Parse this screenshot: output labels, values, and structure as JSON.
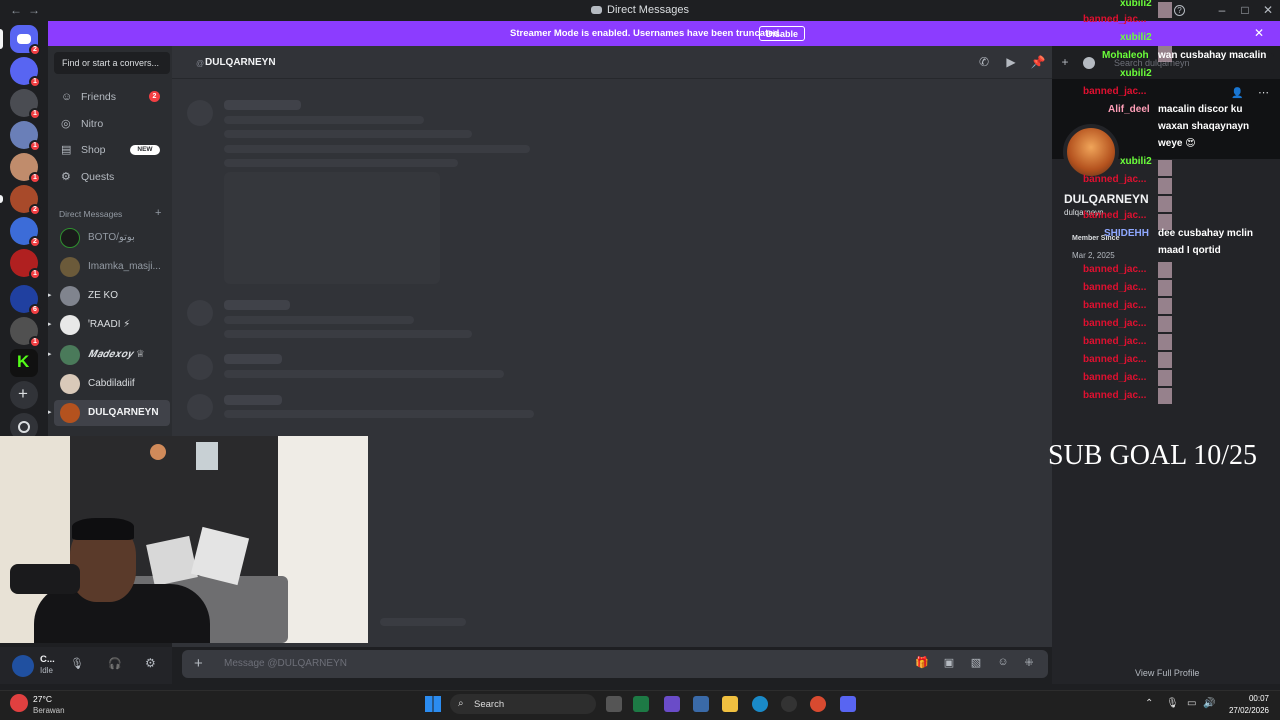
{
  "window": {
    "title": "Direct Messages",
    "back": "←",
    "forward": "→",
    "help": "?",
    "minimize": "–",
    "maximize": "□",
    "close": "✕"
  },
  "banner": {
    "message": "Streamer Mode is enabled. Usernames have been truncated.",
    "disable_label": "Disable",
    "close": "✕"
  },
  "servers": {
    "badges": [
      "2",
      "1",
      "1",
      "1",
      "1",
      "2",
      "2",
      "1",
      "6",
      "1"
    ]
  },
  "sidebar": {
    "search_label": "Find or start a convers...",
    "nav": [
      {
        "label": "Friends",
        "badge": "2"
      },
      {
        "label": "Nitro"
      },
      {
        "label": "Shop",
        "badge_new": "NEW"
      },
      {
        "label": "Quests"
      }
    ],
    "dm_header": "Direct Messages",
    "dm_plus": "+",
    "dms": [
      {
        "name": "BOTO/بوتو"
      },
      {
        "name": "Imamka_masji..."
      },
      {
        "name": "ZE KO"
      },
      {
        "name": "ꞌRAADI ⚡"
      },
      {
        "name": "𝑴𝒂𝒅𝒆𝒙𝒐𝒚 ♕"
      },
      {
        "name": "Cabdiladiif"
      },
      {
        "name": "DULQARNEYN"
      }
    ]
  },
  "header": {
    "at": "@",
    "name": "DULQARNEYN",
    "search_placeholder": "Search dulqarneyn"
  },
  "composer": {
    "placeholder": "Message @DULQARNEYN",
    "plus": "+"
  },
  "user_panel": {
    "name": "C...",
    "status": "Idle"
  },
  "profile": {
    "display_name": "DULQARNEYN",
    "username": "dulqarneyn",
    "member_since_label": "Member Since",
    "member_since": "Mar 2, 2025",
    "view_full": "View Full Profile"
  },
  "chat": [
    {
      "user": "xubili2",
      "color": "green"
    },
    {
      "user": "banned_jac...",
      "color": "red"
    },
    {
      "user": "xubili2",
      "color": "green"
    },
    {
      "user": "Mohaleoh",
      "color": "green",
      "text": "wan cusbahay macalin"
    },
    {
      "user": "xubili2",
      "color": "green"
    },
    {
      "user": "banned_jac...",
      "color": "red"
    },
    {
      "user": "Alif_deel",
      "color": "pink",
      "text": "macalin discor ku waxan shaqaynayn weye 😍"
    },
    {
      "user": "xubili2",
      "color": "green"
    },
    {
      "user": "SHIDEHH",
      "color": "blue",
      "text": "dee cusbahay mclin maad I qortid"
    }
  ],
  "chat_banned": "banned_jac...",
  "sub_goal": "SUB GOAL 10/25",
  "taskbar": {
    "temp": "27°C",
    "weather": "Berawan",
    "search": "Search",
    "time": "00:07",
    "date": "27/02/2026"
  }
}
